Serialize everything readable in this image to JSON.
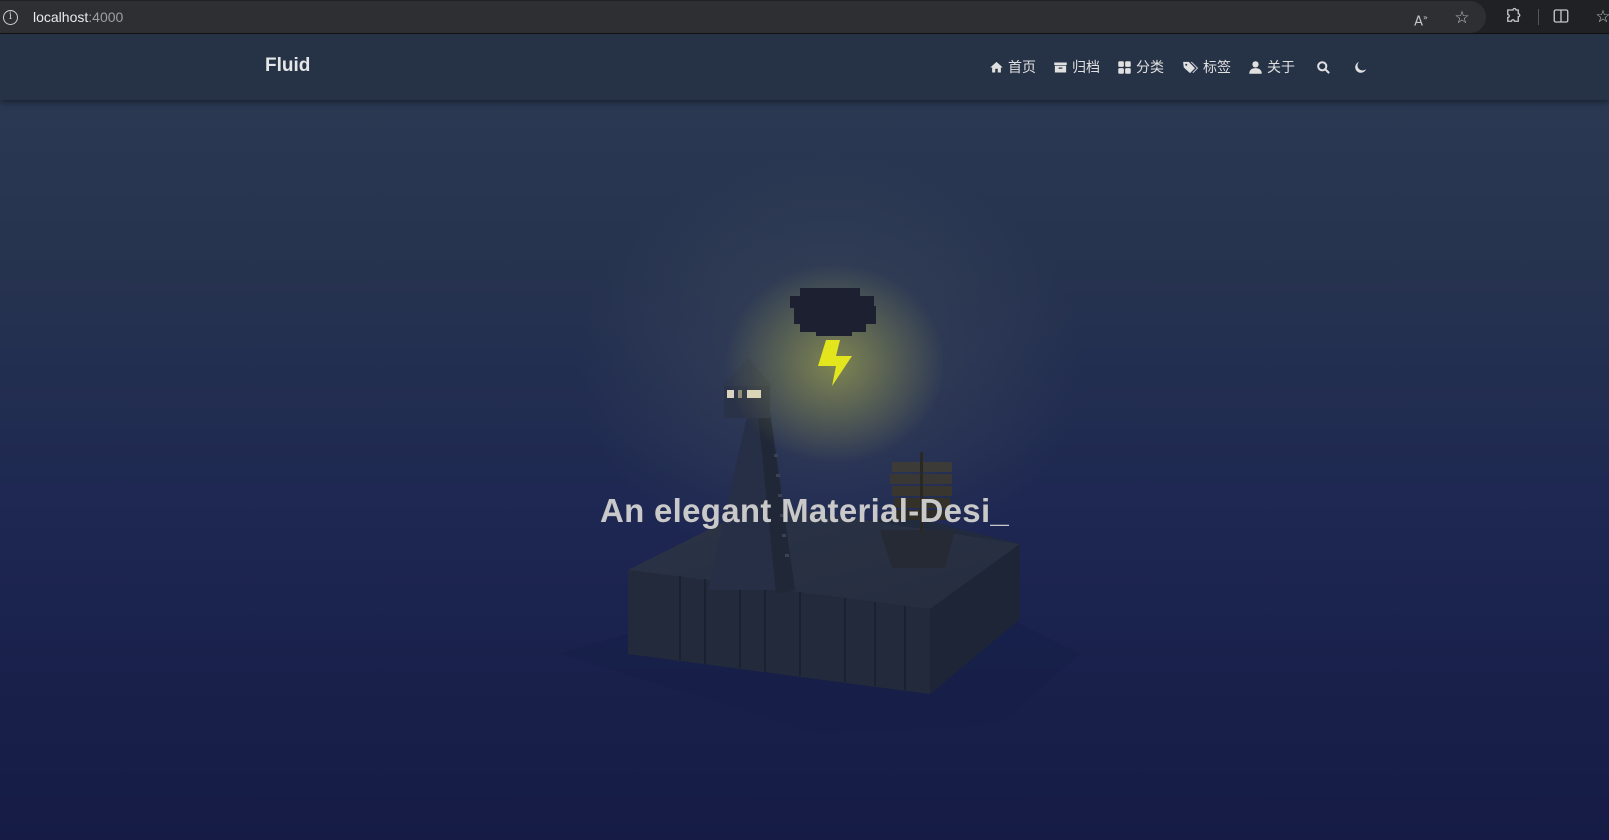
{
  "browser": {
    "url_host": "localhost",
    "url_port": ":4000",
    "icons": [
      "info-icon",
      "read-aloud-icon",
      "favorite-star-icon",
      "extensions-icon",
      "split-screen-icon",
      "favorites-icon"
    ]
  },
  "navbar": {
    "brand": "Fluid",
    "items": [
      {
        "label": "首页",
        "icon": "home-icon"
      },
      {
        "label": "归档",
        "icon": "archive-icon"
      },
      {
        "label": "分类",
        "icon": "grid-icon"
      },
      {
        "label": "标签",
        "icon": "tags-icon"
      },
      {
        "label": "关于",
        "icon": "user-icon"
      }
    ],
    "search_icon": "search-icon",
    "theme_icon": "moon-icon"
  },
  "hero": {
    "title": "An elegant Material-Desi_"
  },
  "colors": {
    "navbar_bg": "#263246",
    "page_bg_top": "#2c3a54",
    "page_bg_bottom": "#151b44",
    "lightning": "#e3e61c",
    "title": "#c9c9c9"
  }
}
